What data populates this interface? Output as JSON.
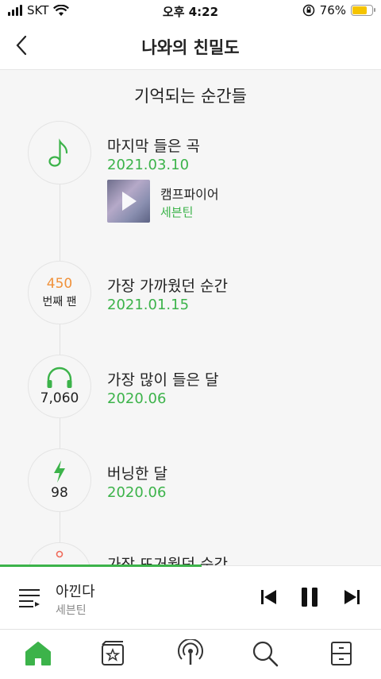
{
  "status_bar": {
    "carrier": "SKT",
    "time": "오후 4:22",
    "battery": "76%",
    "battery_level": 0.76
  },
  "header": {
    "title": "나와의 친밀도",
    "back_icon": "chevron-left-icon"
  },
  "section_title": "기억되는 순간들",
  "moments": [
    {
      "icon": "music-note-icon",
      "title": "마지막 들은 곡",
      "date": "2021.03.10",
      "song": {
        "name": "캠프파이어",
        "artist": "세븐틴"
      }
    },
    {
      "value": "450",
      "sub": "번째 팬",
      "title": "가장 가까웠던 순간",
      "date": "2021.01.15"
    },
    {
      "icon": "headphones-icon",
      "value": "7,060",
      "title": "가장 많이 들은 달",
      "date": "2020.06"
    },
    {
      "icon": "lightning-icon",
      "value": "98",
      "title": "버닝한 달",
      "date": "2020.06"
    },
    {
      "title": "가장 뜨거웠던 순간"
    }
  ],
  "player": {
    "title": "아낀다",
    "artist": "세븐틴",
    "progress": 0.53
  },
  "tabs": [
    "home-icon",
    "library-icon",
    "podcast-icon",
    "search-icon",
    "storage-icon"
  ],
  "colors": {
    "accent": "#3cb34a",
    "orange": "#f0913a"
  }
}
